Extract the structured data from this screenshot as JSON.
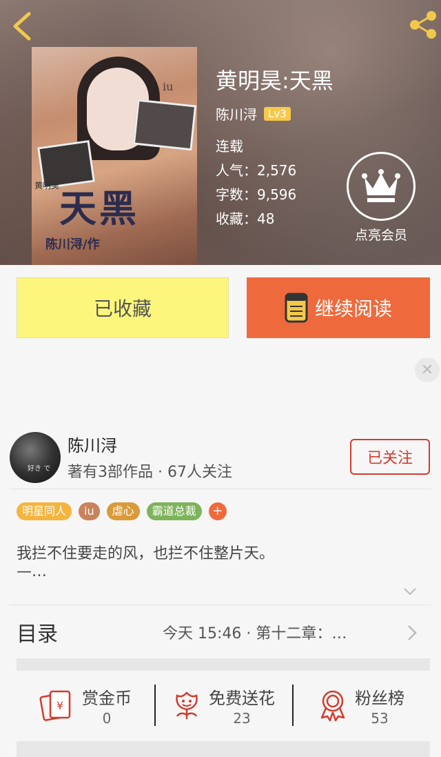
{
  "header": {
    "back_icon": "chevron-left-icon",
    "share_icon": "share-icon"
  },
  "cover": {
    "title_art": "天黑",
    "author_art": "陈川浔/作",
    "small_text": "黄明昊",
    "iu_text": "iu"
  },
  "book": {
    "title": "黄明昊:天黑",
    "author": "陈川浔",
    "level": "Lv3",
    "status": "连载",
    "popularity": "人气：2,576",
    "word_count": "字数：9,596",
    "favorites": "收藏：48"
  },
  "vip": {
    "icon": "crown-icon",
    "label": "点亮会员"
  },
  "actions": {
    "favorited_label": "已收藏",
    "read_label": "继续阅读"
  },
  "author_card": {
    "name": "陈川浔",
    "stats": "著有3部作品 · 67人关注",
    "follow_label": "已关注",
    "avatar_text": "好き で"
  },
  "tags": [
    {
      "label": "明星同人",
      "color": "#f4b43e"
    },
    {
      "label": "iu",
      "color": "#c9825a"
    },
    {
      "label": "虐心",
      "color": "#d99a3a"
    },
    {
      "label": "霸道总裁",
      "color": "#7db35a"
    },
    {
      "label": "+",
      "color": "#ee6a3c"
    }
  ],
  "description": {
    "line1": "我拦不住要走的风，也拦不住整片天。",
    "line2": "—…"
  },
  "toc": {
    "label": "目录",
    "update": "今天 15:46  ·  第十二章：…"
  },
  "stats": [
    {
      "label": "赏金币",
      "value": "0",
      "icon": "red-envelope-icon"
    },
    {
      "label": "免费送花",
      "value": "23",
      "icon": "flower-icon"
    },
    {
      "label": "粉丝榜",
      "value": "53",
      "icon": "medal-icon"
    }
  ],
  "colors": {
    "accent": "#ee6a3c",
    "favorite_bg": "#fcf77c",
    "follow_red": "#d43a2c"
  }
}
